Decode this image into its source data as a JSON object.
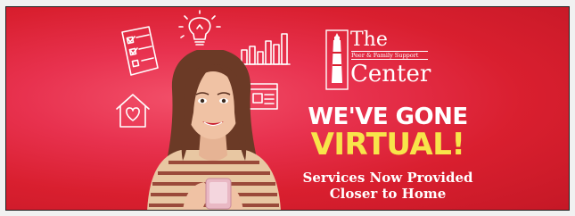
{
  "logo": {
    "title_line1": "The",
    "subtitle": "Peer & Family Support",
    "title_line2": "Center"
  },
  "headline": {
    "line1": "WE'VE GONE",
    "line2": "VIRTUAL!"
  },
  "subheadline": {
    "line1": "Services Now Provided",
    "line2": "Closer to Home"
  },
  "colors": {
    "background": "#d91f2f",
    "accent_yellow": "#f8e44a",
    "text_white": "#ffffff"
  },
  "icons": [
    "checklist-icon",
    "lightbulb-icon",
    "bar-chart-icon",
    "house-heart-icon",
    "browser-window-icon",
    "lighthouse-icon",
    "smartphone-icon"
  ]
}
